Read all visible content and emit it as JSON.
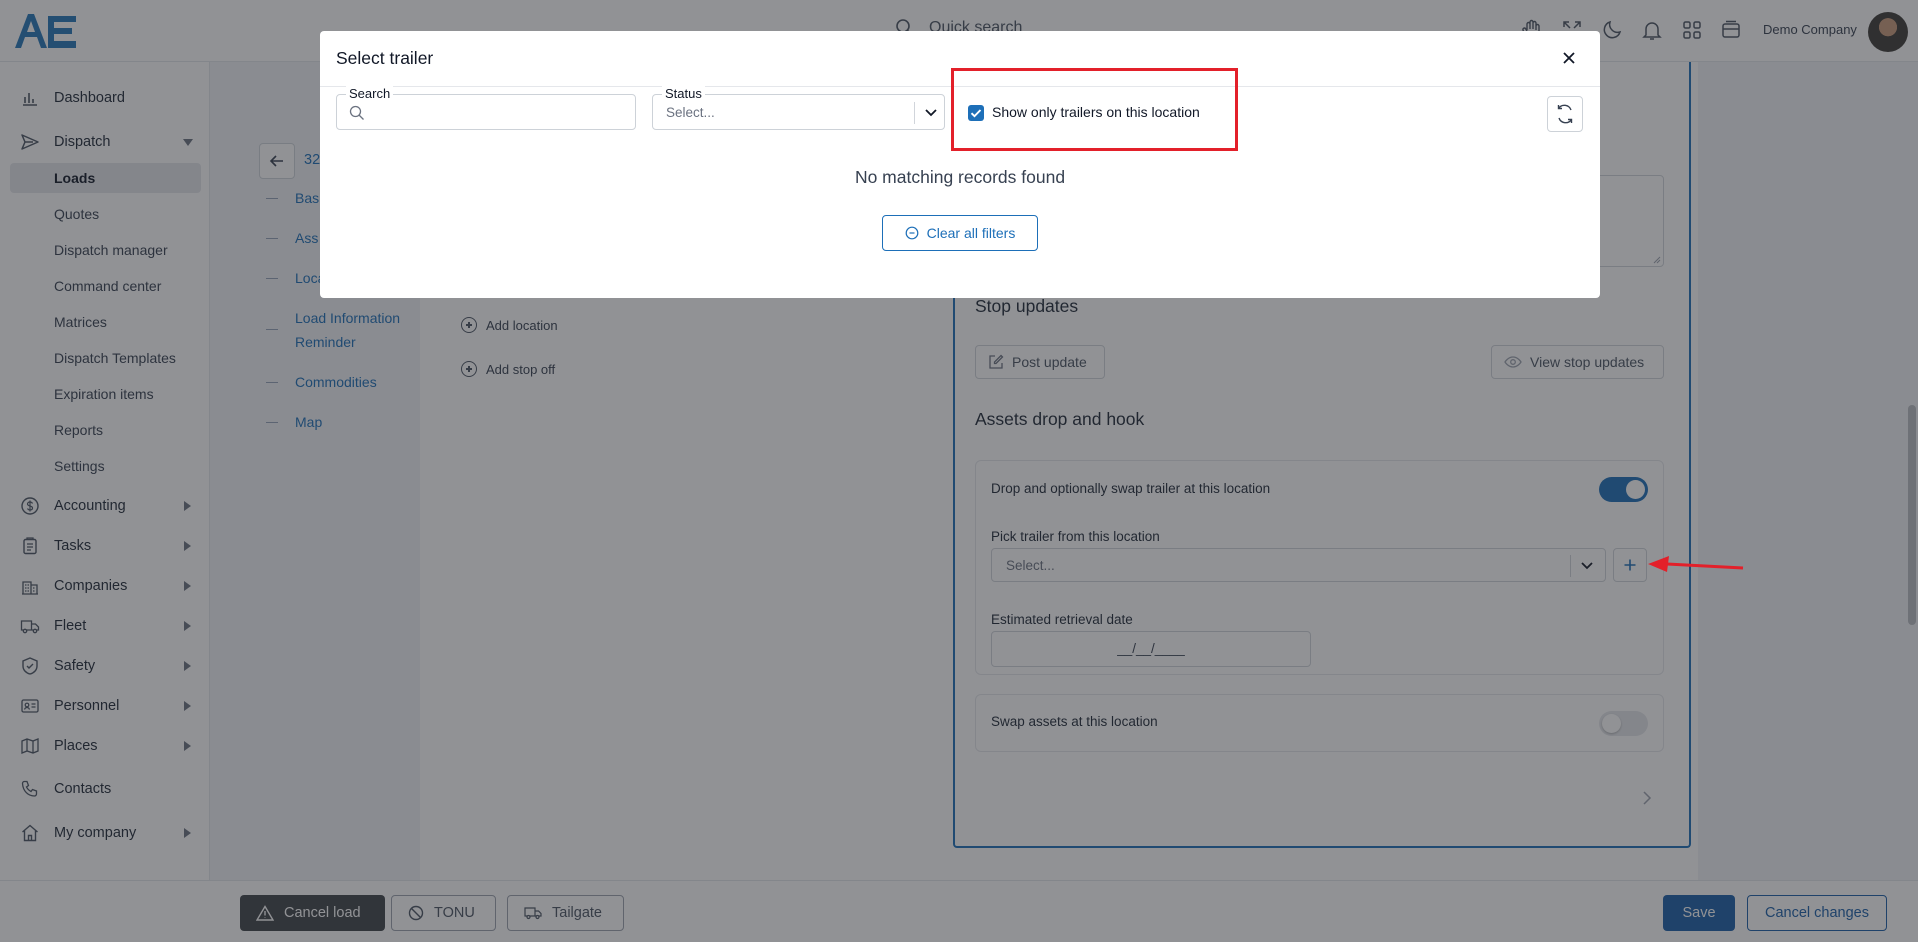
{
  "topbar": {
    "search_placeholder": "Quick search",
    "company": "Demo Company",
    "icons": [
      "hand-icon",
      "fullscreen-icon",
      "moon-icon",
      "bell-icon",
      "apps-grid-icon",
      "archive-box-icon"
    ]
  },
  "sidebar": {
    "items": [
      {
        "label": "Dashboard",
        "icon": "bar-chart-icon"
      },
      {
        "label": "Dispatch",
        "icon": "send-icon"
      },
      {
        "label": "Accounting",
        "icon": "dollar-icon"
      },
      {
        "label": "Tasks",
        "icon": "clipboard-icon"
      },
      {
        "label": "Companies",
        "icon": "building-icon"
      },
      {
        "label": "Fleet",
        "icon": "truck-icon"
      },
      {
        "label": "Safety",
        "icon": "shield-icon"
      },
      {
        "label": "Personnel",
        "icon": "id-card-icon"
      },
      {
        "label": "Places",
        "icon": "map-icon"
      },
      {
        "label": "Contacts",
        "icon": "phone-icon"
      },
      {
        "label": "My company",
        "icon": "home-icon"
      }
    ],
    "dispatch_sub": [
      "Loads",
      "Quotes",
      "Dispatch manager",
      "Command center",
      "Matrices",
      "Dispatch Templates",
      "Expiration items",
      "Reports",
      "Settings"
    ]
  },
  "toc": {
    "load_number_partial": "32",
    "items": [
      "Bas",
      "Ass",
      "Loca",
      "Load Information",
      "Reminder",
      "Commodities",
      "Map"
    ]
  },
  "content": {
    "add_location": "Add location",
    "add_stop_off": "Add stop off",
    "stop_updates_title": "Stop updates",
    "post_update": "Post update",
    "view_stop_updates": "View stop updates",
    "assets_title": "Assets drop and hook",
    "drop_label": "Drop and optionally swap trailer at this location",
    "drop_toggle_on": true,
    "pick_trailer_label": "Pick trailer from this location",
    "pick_trailer_placeholder": "Select...",
    "retrieval_label": "Estimated retrieval date",
    "retrieval_mask": "__/__/____",
    "swap_label": "Swap assets at this location",
    "swap_toggle_on": false
  },
  "bottombar": {
    "cancel_load": "Cancel load",
    "tonu": "TONU",
    "tailgate": "Tailgate",
    "save": "Save",
    "cancel_changes": "Cancel changes"
  },
  "modal": {
    "title": "Select trailer",
    "search_label": "Search",
    "status_label": "Status",
    "status_placeholder": "Select...",
    "checkbox_label": "Show only trailers on this location",
    "checkbox_checked": true,
    "empty_message": "No matching records found",
    "clear_filters": "Clear all filters"
  },
  "colors": {
    "accent": "#1d6fb8",
    "primary_button": "#1b5fa8",
    "annotation_red": "#e3202a"
  }
}
